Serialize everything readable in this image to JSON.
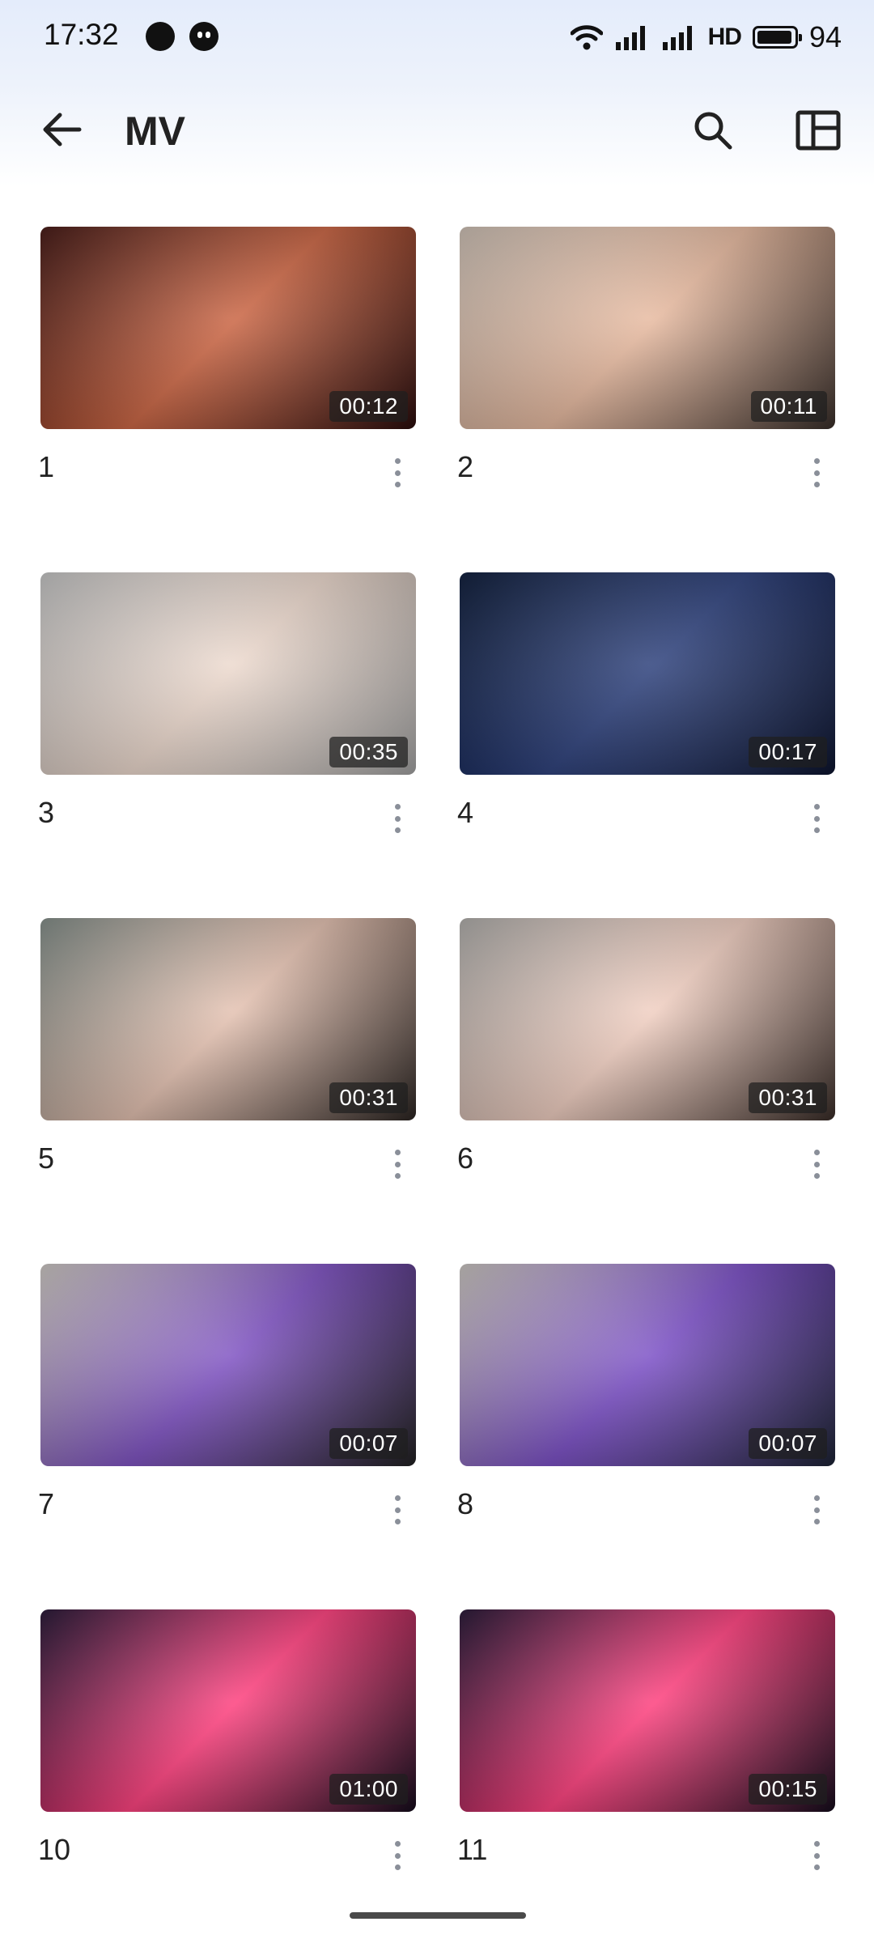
{
  "status_bar": {
    "time": "17:32",
    "network_badge": "HD",
    "battery_percent": "94",
    "icons": [
      "notification-icon",
      "chat-notification-icon",
      "wifi-icon",
      "signal-5g-icon",
      "signal-5g-icon",
      "battery-icon"
    ]
  },
  "app_bar": {
    "title": "MV",
    "back_icon": "arrow-left-icon",
    "search_icon": "search-icon",
    "layout_icon": "layout-toggle-icon"
  },
  "videos": [
    {
      "title": "1",
      "duration": "00:12",
      "thumb_colors": [
        "#4a1c18",
        "#c9603d",
        "#2a0c0c"
      ]
    },
    {
      "title": "2",
      "duration": "00:11",
      "thumb_colors": [
        "#d9cbbf",
        "#e6b79c",
        "#3a2f2a"
      ]
    },
    {
      "title": "3",
      "duration": "00:35",
      "thumb_colors": [
        "#cfcfcf",
        "#ecd8cc",
        "#a8a8a8"
      ]
    },
    {
      "title": "4",
      "duration": "00:17",
      "thumb_colors": [
        "#11203f",
        "#273b78",
        "#0d1530"
      ]
    },
    {
      "title": "5",
      "duration": "00:31",
      "thumb_colors": [
        "#8a9590",
        "#e3bfae",
        "#2c2522"
      ]
    },
    {
      "title": "6",
      "duration": "00:31",
      "thumb_colors": [
        "#b9b7b4",
        "#f0cdbf",
        "#3a2d28"
      ]
    },
    {
      "title": "7",
      "duration": "00:07",
      "thumb_colors": [
        "#d8d3ce",
        "#7a4cc0",
        "#222222"
      ]
    },
    {
      "title": "8",
      "duration": "00:07",
      "thumb_colors": [
        "#d5d0cb",
        "#7649c4",
        "#1d2436"
      ]
    },
    {
      "title": "10",
      "duration": "01:00",
      "thumb_colors": [
        "#2a1a3a",
        "#ff3a7a",
        "#140c1c"
      ]
    },
    {
      "title": "11",
      "duration": "00:15",
      "thumb_colors": [
        "#2a1a3a",
        "#ff3a7a",
        "#140c1c"
      ]
    }
  ],
  "more_icon": "more-vertical-icon"
}
